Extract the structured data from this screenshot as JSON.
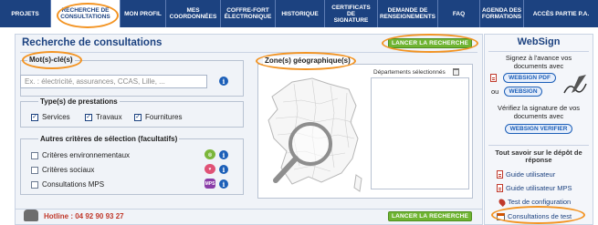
{
  "nav": {
    "items": [
      {
        "label": "PROJETS"
      },
      {
        "label": "RECHERCHE DE\nCONSULTATIONS"
      },
      {
        "label": "MON PROFIL"
      },
      {
        "label": "MES\nCOORDONNÉES"
      },
      {
        "label": "COFFRE-FORT\nÉLECTRONIQUE"
      },
      {
        "label": "HISTORIQUE"
      },
      {
        "label": "CERTIFICATS DE\nSIGNATURE"
      },
      {
        "label": "DEMANDE DE\nRENSEIGNEMENTS"
      },
      {
        "label": "FAQ"
      },
      {
        "label": "AGENDA DES\nFORMATIONS"
      },
      {
        "label": "ACCÈS PARTIE P.A."
      }
    ]
  },
  "main": {
    "title": "Recherche de consultations",
    "search_button": "LANCER LA RECHERCHE",
    "search_button_bottom": "LANCER LA RECHERCHE",
    "keywords": {
      "title": "Mot(s)-clé(s)",
      "placeholder": "Ex. : électricité, assurances, CCAS, Lille, ..."
    },
    "prestations": {
      "title": "Type(s) de prestations",
      "options": [
        {
          "label": "Services",
          "checked": true
        },
        {
          "label": "Travaux",
          "checked": true
        },
        {
          "label": "Fournitures",
          "checked": true
        }
      ]
    },
    "criteria": {
      "title": "Autres critères de sélection (facultatifs)",
      "options": [
        {
          "label": "Critères environnementaux",
          "checked": false
        },
        {
          "label": "Critères sociaux",
          "checked": false
        },
        {
          "label": "Consultations MPS",
          "checked": false,
          "badge": "MPS"
        }
      ]
    },
    "zones": {
      "title": "Zone(s) géographique(s)",
      "selected_label": "Départements sélectionnés"
    },
    "hotline": "Hotline : 04 92 90 93 27"
  },
  "sidebar": {
    "title": "WebSign",
    "intro": "Signez à l'avance vos documents avec",
    "pdf_button": "WEBSIGN PDF",
    "or_label": "ou",
    "websign_button": "WEBSIGN",
    "verify_text": "Vérifiez la signature de vos documents avec",
    "verify_button": "WEBSIGN VERIFIER",
    "deposit_heading": "Tout savoir sur le dépôt de réponse",
    "links": [
      {
        "label": "Guide utilisateur"
      },
      {
        "label": "Guide utilisateur MPS"
      },
      {
        "label": "Test de configuration"
      },
      {
        "label": "Consultations de test"
      }
    ]
  },
  "colors": {
    "nav_bg": "#1c4280",
    "accent_green": "#6fb432",
    "highlight_orange": "#f39423",
    "info_blue": "#1c5fb8"
  }
}
